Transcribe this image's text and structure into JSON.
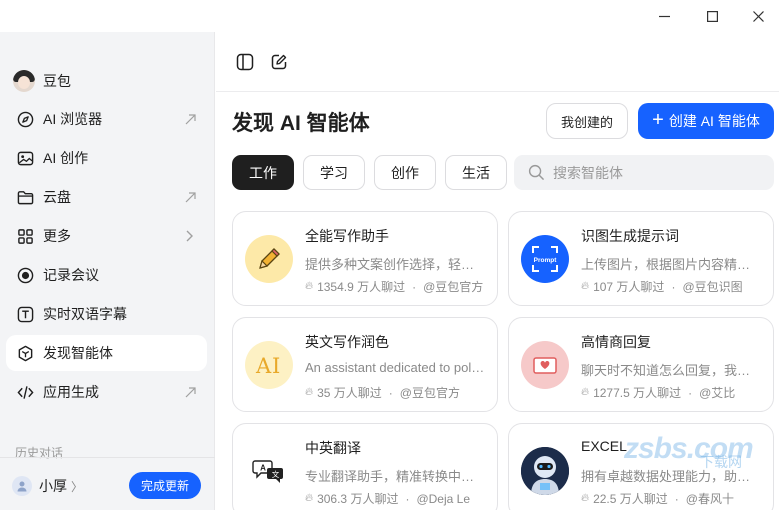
{
  "sidebar": {
    "user_name": "豆包",
    "items": [
      {
        "label": "AI 浏览器",
        "trail": "arrow"
      },
      {
        "label": "AI 创作",
        "trail": ""
      },
      {
        "label": "云盘",
        "trail": "arrow"
      },
      {
        "label": "更多",
        "trail": "chevron"
      },
      {
        "label": "记录会议",
        "trail": ""
      },
      {
        "label": "实时双语字幕",
        "trail": ""
      },
      {
        "label": "发现智能体",
        "trail": "",
        "active": true
      },
      {
        "label": "应用生成",
        "trail": "arrow"
      }
    ],
    "history_label": "历史对话",
    "account_name": "小厚",
    "update_button": "完成更新"
  },
  "main": {
    "title": "发现 AI 智能体",
    "mine_button": "我创建的",
    "create_button": "创建 AI 智能体",
    "tabs": [
      "工作",
      "学习",
      "创作",
      "生活"
    ],
    "active_tab": "工作",
    "search_placeholder": "搜索智能体"
  },
  "cards": [
    {
      "title": "全能写作助手",
      "desc": "提供多种文案创作选择，轻松搞定各类写作",
      "count": "1354.9 万人聊过",
      "author": "@豆包官方",
      "icon": "pencil-icon"
    },
    {
      "title": "识图生成提示词",
      "desc": "上传图片，根据图片内容精准生成提示词",
      "count": "107 万人聊过",
      "author": "@豆包识图",
      "icon": "prompt-scan-icon"
    },
    {
      "title": "英文写作润色",
      "desc": "An assistant dedicated to polishing English writing",
      "count": "35 万人聊过",
      "author": "@豆包官方",
      "icon": "ai-text-icon"
    },
    {
      "title": "高情商回复",
      "desc": "聊天时不知道怎么回复，我来帮你",
      "count": "1277.5 万人聊过",
      "author": "@艾比",
      "icon": "heart-mail-icon"
    },
    {
      "title": "中英翻译",
      "desc": "专业翻译助手，精准转换中英文内容",
      "count": "306.3 万人聊过",
      "author": "@Deja Le",
      "icon": "translate-icon"
    },
    {
      "title": "EXCEL",
      "desc": "拥有卓越数据处理能力，助你高效办公",
      "count": "22.5 万人聊过",
      "author": "@春风十",
      "icon": "robot-avatar-icon"
    }
  ],
  "watermark": {
    "text": "zsbs.com",
    "sub": "下载网"
  },
  "colors": {
    "accent": "#1662ff",
    "sidebar_bg": "#f3f4f6",
    "active_tab_bg": "#1f1f1f"
  }
}
